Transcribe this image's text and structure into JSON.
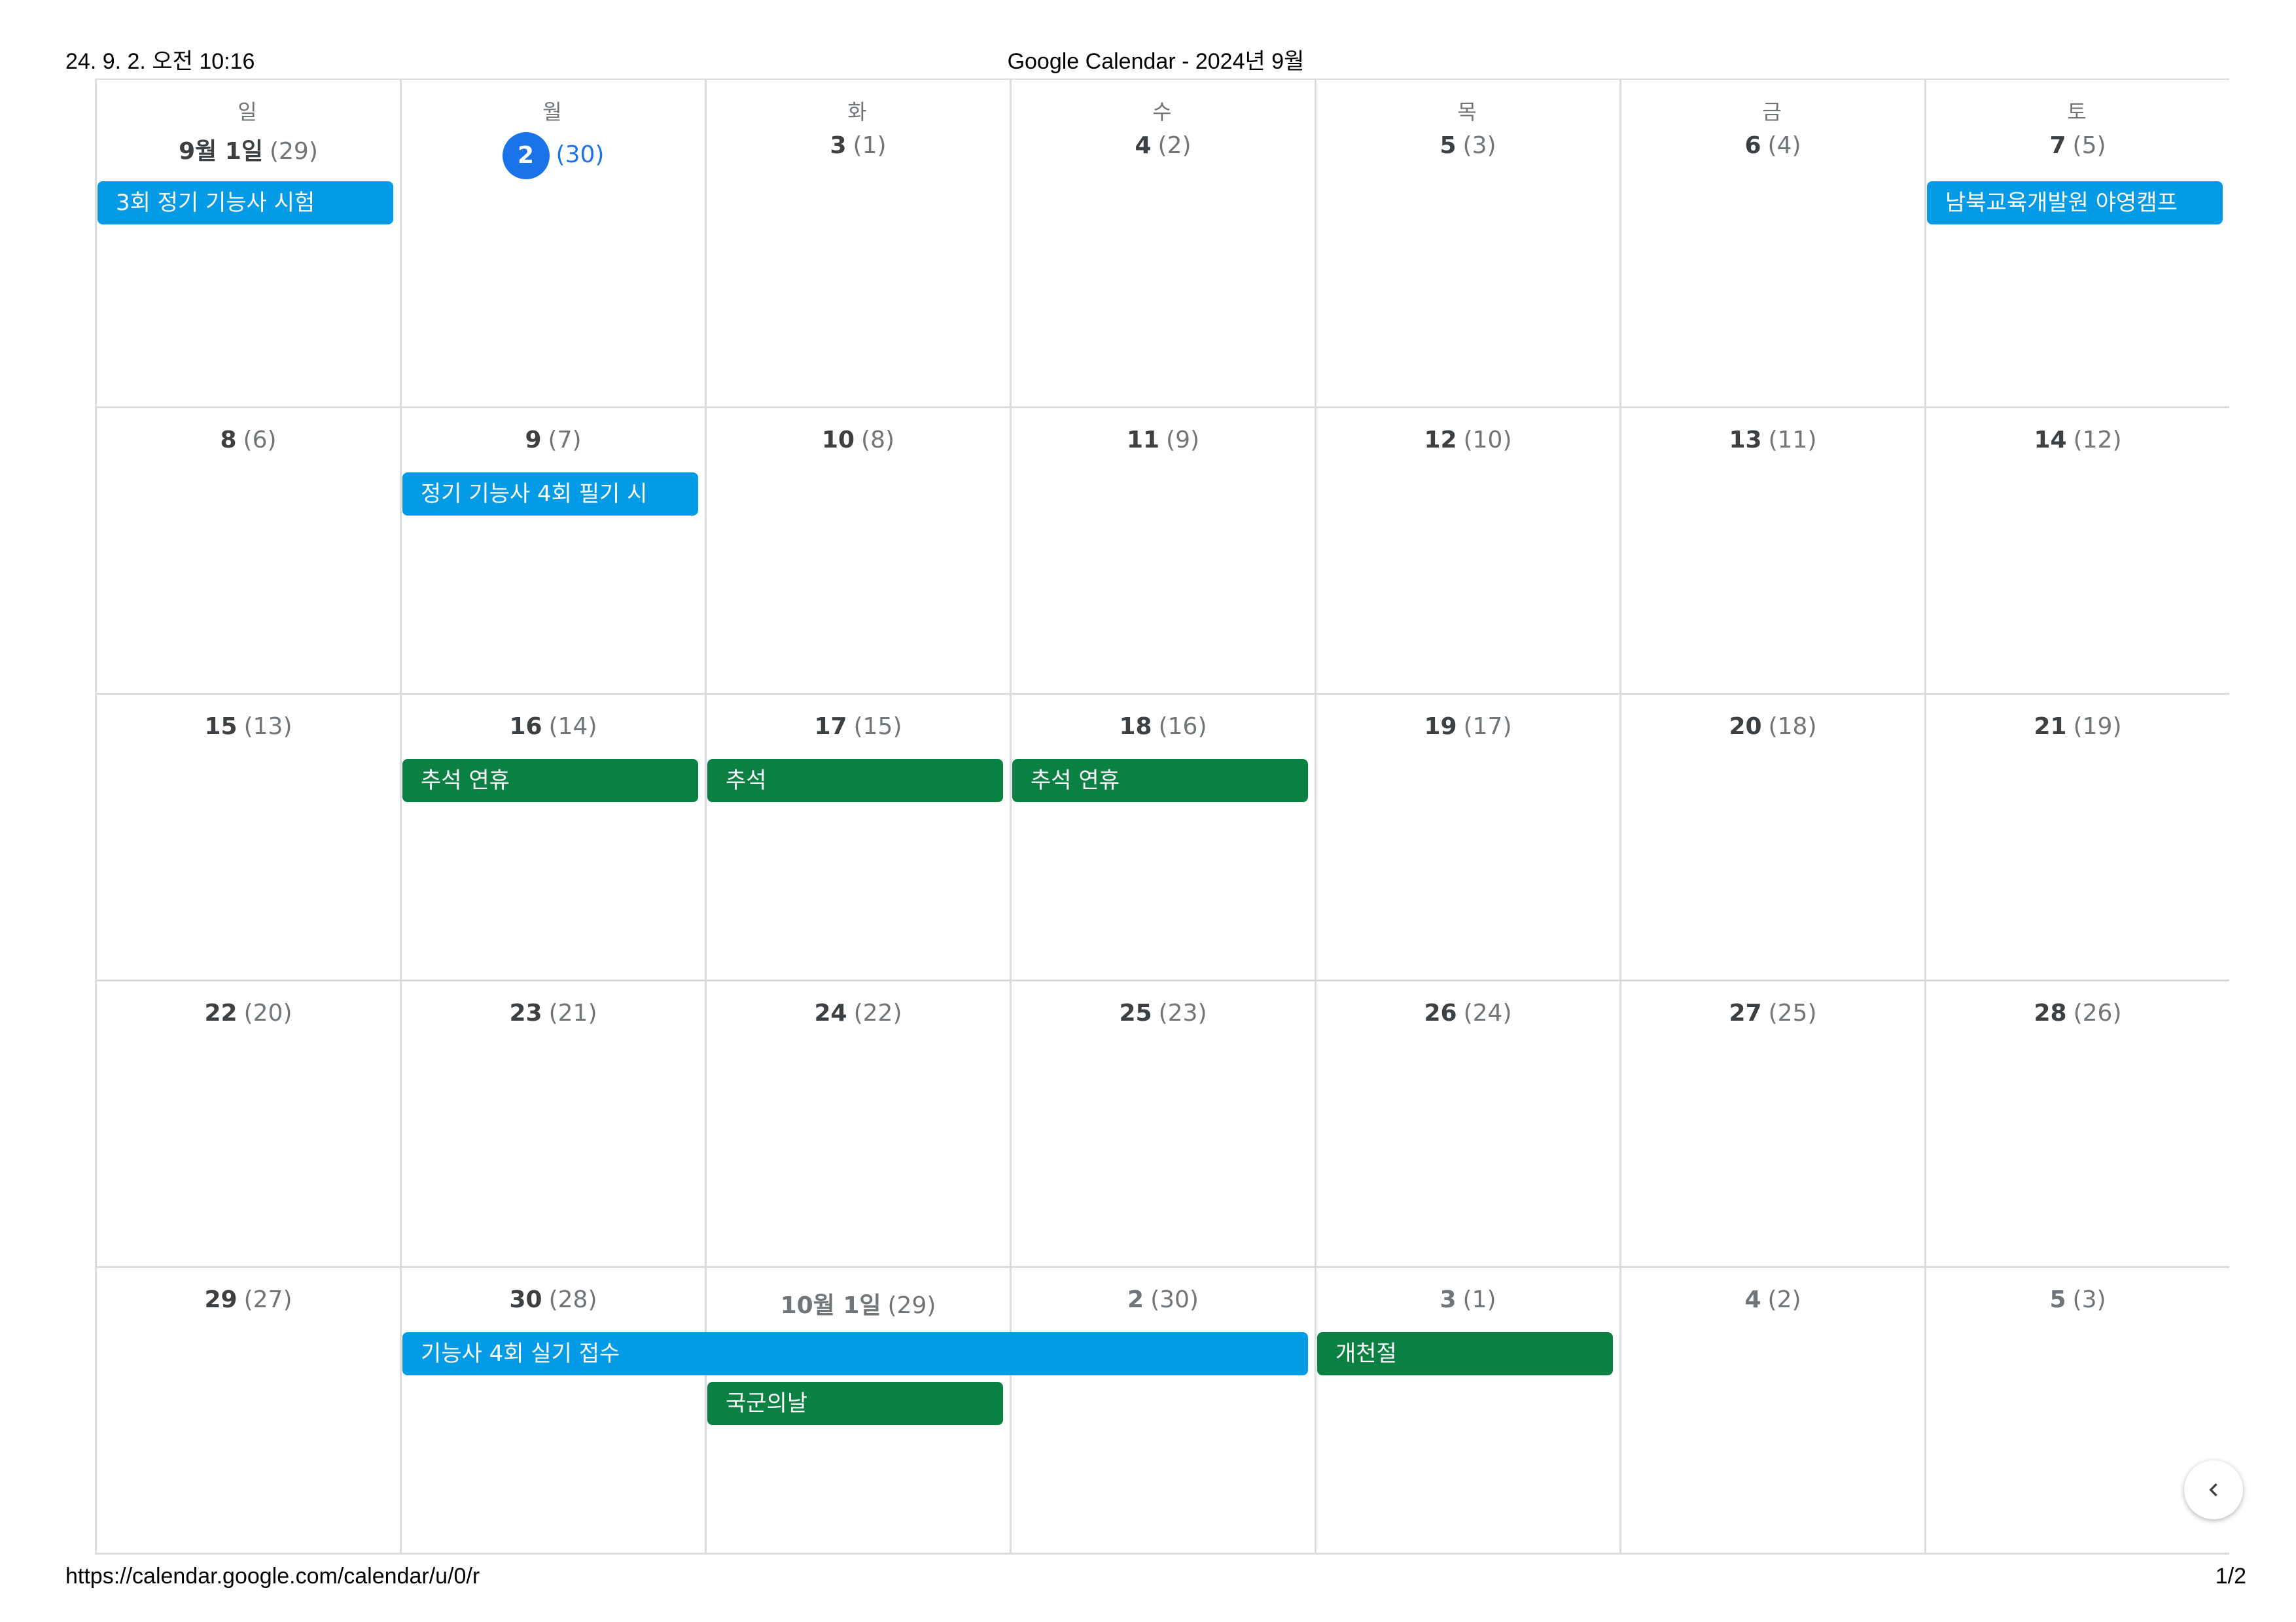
{
  "print": {
    "timestamp": "24. 9. 2. 오전 10:16",
    "title": "Google Calendar - 2024년 9월",
    "url": "https://calendar.google.com/calendar/u/0/r",
    "page": "1/2"
  },
  "calendar": {
    "weekdays": [
      "일",
      "월",
      "화",
      "수",
      "목",
      "금",
      "토"
    ],
    "weeks": [
      [
        {
          "num": "9월 1일",
          "lunar": "(29)",
          "today": false,
          "other": false
        },
        {
          "num": "2",
          "lunar": "(30)",
          "today": true,
          "other": false
        },
        {
          "num": "3",
          "lunar": "(1)",
          "today": false,
          "other": false
        },
        {
          "num": "4",
          "lunar": "(2)",
          "today": false,
          "other": false
        },
        {
          "num": "5",
          "lunar": "(3)",
          "today": false,
          "other": false
        },
        {
          "num": "6",
          "lunar": "(4)",
          "today": false,
          "other": false
        },
        {
          "num": "7",
          "lunar": "(5)",
          "today": false,
          "other": false
        }
      ],
      [
        {
          "num": "8",
          "lunar": "(6)",
          "today": false,
          "other": false
        },
        {
          "num": "9",
          "lunar": "(7)",
          "today": false,
          "other": false
        },
        {
          "num": "10",
          "lunar": "(8)",
          "today": false,
          "other": false
        },
        {
          "num": "11",
          "lunar": "(9)",
          "today": false,
          "other": false
        },
        {
          "num": "12",
          "lunar": "(10)",
          "today": false,
          "other": false
        },
        {
          "num": "13",
          "lunar": "(11)",
          "today": false,
          "other": false
        },
        {
          "num": "14",
          "lunar": "(12)",
          "today": false,
          "other": false
        }
      ],
      [
        {
          "num": "15",
          "lunar": "(13)",
          "today": false,
          "other": false
        },
        {
          "num": "16",
          "lunar": "(14)",
          "today": false,
          "other": false
        },
        {
          "num": "17",
          "lunar": "(15)",
          "today": false,
          "other": false
        },
        {
          "num": "18",
          "lunar": "(16)",
          "today": false,
          "other": false
        },
        {
          "num": "19",
          "lunar": "(17)",
          "today": false,
          "other": false
        },
        {
          "num": "20",
          "lunar": "(18)",
          "today": false,
          "other": false
        },
        {
          "num": "21",
          "lunar": "(19)",
          "today": false,
          "other": false
        }
      ],
      [
        {
          "num": "22",
          "lunar": "(20)",
          "today": false,
          "other": false
        },
        {
          "num": "23",
          "lunar": "(21)",
          "today": false,
          "other": false
        },
        {
          "num": "24",
          "lunar": "(22)",
          "today": false,
          "other": false
        },
        {
          "num": "25",
          "lunar": "(23)",
          "today": false,
          "other": false
        },
        {
          "num": "26",
          "lunar": "(24)",
          "today": false,
          "other": false
        },
        {
          "num": "27",
          "lunar": "(25)",
          "today": false,
          "other": false
        },
        {
          "num": "28",
          "lunar": "(26)",
          "today": false,
          "other": false
        }
      ],
      [
        {
          "num": "29",
          "lunar": "(27)",
          "today": false,
          "other": false
        },
        {
          "num": "30",
          "lunar": "(28)",
          "today": false,
          "other": false
        },
        {
          "num": "10월 1일",
          "lunar": "(29)",
          "today": false,
          "other": true
        },
        {
          "num": "2",
          "lunar": "(30)",
          "today": false,
          "other": true
        },
        {
          "num": "3",
          "lunar": "(1)",
          "today": false,
          "other": true
        },
        {
          "num": "4",
          "lunar": "(2)",
          "today": false,
          "other": true
        },
        {
          "num": "5",
          "lunar": "(3)",
          "today": false,
          "other": true
        }
      ]
    ],
    "events": [
      {
        "title": "3회 정기 기능사 시험",
        "week": 0,
        "startDay": 0,
        "span": 1,
        "lane": 0,
        "color": "blue"
      },
      {
        "title": "남북교육개발원 야영캠프",
        "week": 0,
        "startDay": 6,
        "span": 1,
        "lane": 0,
        "color": "blue"
      },
      {
        "title": "정기 기능사 4회 필기 시",
        "week": 1,
        "startDay": 1,
        "span": 1,
        "lane": 0,
        "color": "blue"
      },
      {
        "title": "추석 연휴",
        "week": 2,
        "startDay": 1,
        "span": 1,
        "lane": 0,
        "color": "green"
      },
      {
        "title": "추석",
        "week": 2,
        "startDay": 2,
        "span": 1,
        "lane": 0,
        "color": "green"
      },
      {
        "title": "추석 연휴",
        "week": 2,
        "startDay": 3,
        "span": 1,
        "lane": 0,
        "color": "green"
      },
      {
        "title": "기능사 4회 실기 접수",
        "week": 4,
        "startDay": 1,
        "span": 3,
        "lane": 0,
        "color": "blue"
      },
      {
        "title": "개천절",
        "week": 4,
        "startDay": 4,
        "span": 1,
        "lane": 0,
        "color": "green"
      },
      {
        "title": "국군의날",
        "week": 4,
        "startDay": 2,
        "span": 1,
        "lane": 1,
        "color": "green"
      }
    ],
    "colors": {
      "blue": "#039be5",
      "green": "#0b8043",
      "today": "#1a73e8"
    }
  },
  "nav": {
    "icon": "chevron-left-icon"
  }
}
